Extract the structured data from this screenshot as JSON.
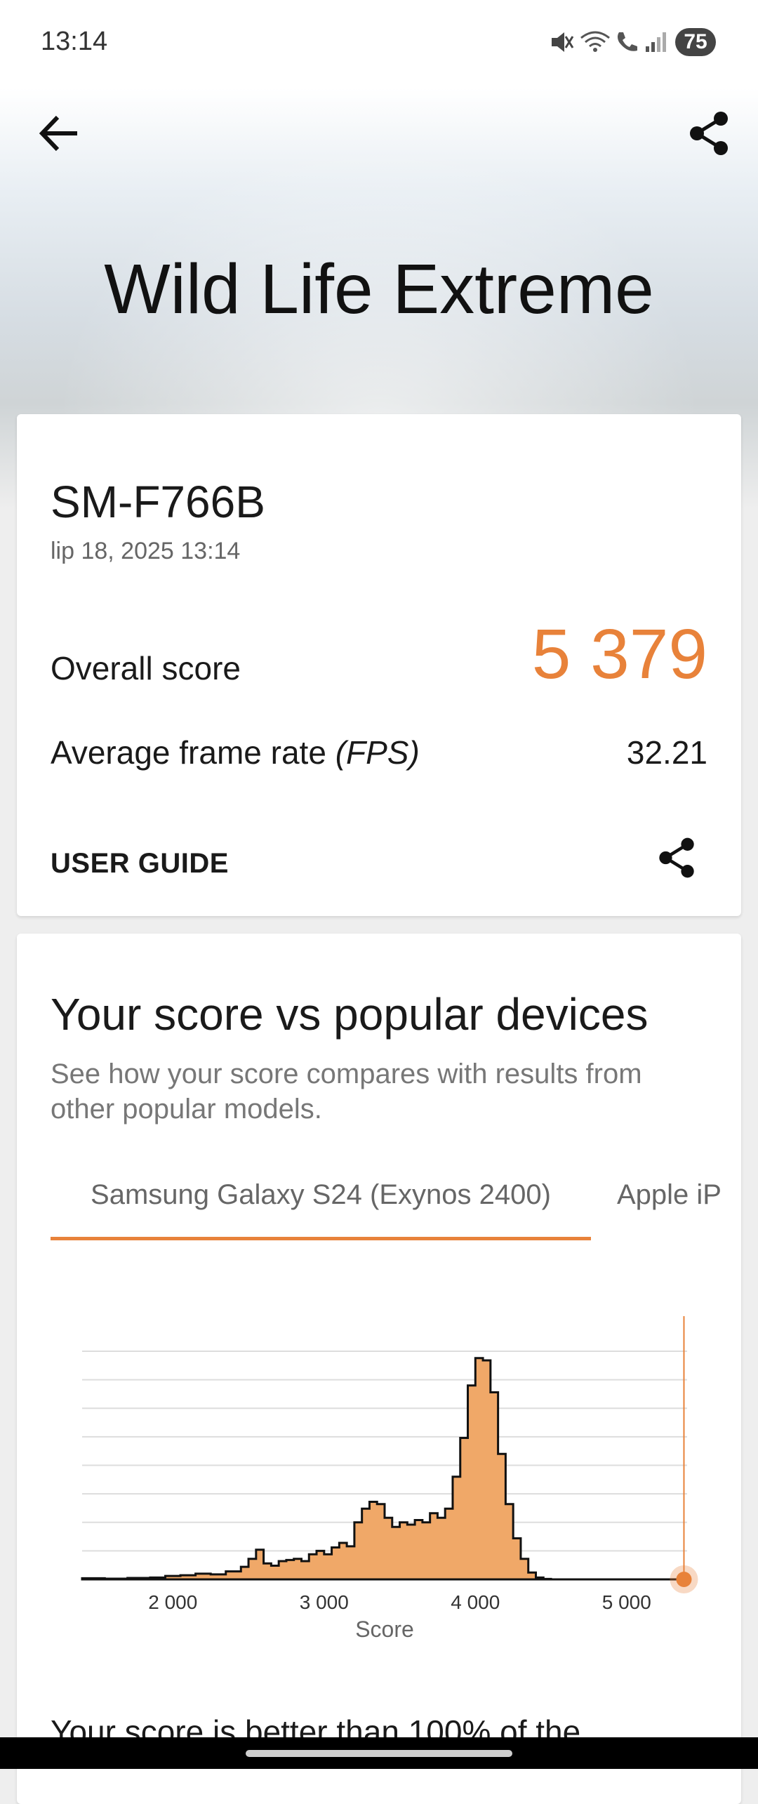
{
  "status_bar": {
    "time": "13:14",
    "battery": "75"
  },
  "hero": {
    "title": "Wild Life Extreme"
  },
  "result": {
    "device": "SM-F766B",
    "date": "lip 18, 2025 13:14",
    "overall_label": "Overall score",
    "overall_value": "5 379",
    "fps_label": "Average frame rate ",
    "fps_unit": "(FPS)",
    "fps_value": "32.21",
    "user_guide": "USER GUIDE"
  },
  "compare": {
    "title": "Your score vs popular devices",
    "description": "See how your score compares with results from other popular models.",
    "tabs": [
      {
        "label": "Samsung Galaxy S24 (Exynos 2400)",
        "active": true
      },
      {
        "label": "Apple iP",
        "active": false
      }
    ],
    "partial_footer": "Your score is better than 100% of the"
  },
  "colors": {
    "accent": "#e8823a",
    "histogram_fill": "#f0a868"
  },
  "icons": [
    "back-arrow-icon",
    "share-icon",
    "muted-icon",
    "wifi-call-icon",
    "call-icon",
    "signal-icon"
  ],
  "chart_data": {
    "type": "area",
    "xlabel": "Score",
    "xlim": [
      1400,
      5400
    ],
    "x_ticks": [
      2000,
      3000,
      4000,
      5000
    ],
    "x_tick_labels": [
      "2 000",
      "3 000",
      "4 000",
      "5 000"
    ],
    "grid": true,
    "y_grid_lines": 8,
    "series": [
      {
        "values_x": [
          1400,
          1550,
          1700,
          1850,
          1950,
          2050,
          2150,
          2250,
          2350,
          2450,
          2500,
          2550,
          2600,
          2650,
          2700,
          2750,
          2800,
          2850,
          2900,
          2950,
          3000,
          3050,
          3100,
          3150,
          3200,
          3250,
          3300,
          3350,
          3400,
          3450,
          3500,
          3550,
          3600,
          3650,
          3700,
          3750,
          3800,
          3850,
          3900,
          3950,
          4000,
          4050,
          4100,
          4150,
          4200,
          4250,
          4300,
          4350,
          4400,
          4450,
          4500
        ],
        "values_y": [
          0.5,
          0.3,
          0.6,
          0.8,
          1.5,
          1.8,
          2.5,
          2.2,
          3.5,
          5.5,
          9,
          13,
          7,
          6,
          8,
          8.5,
          9,
          8,
          11,
          12.5,
          11,
          14,
          16,
          14.5,
          25,
          31,
          34,
          33,
          27,
          23,
          25,
          24,
          26,
          25,
          29,
          27,
          31,
          45,
          62,
          85,
          97,
          96,
          82,
          55,
          33,
          18,
          9,
          3,
          0.8,
          0.2,
          0
        ]
      }
    ],
    "your_score": 5379
  }
}
